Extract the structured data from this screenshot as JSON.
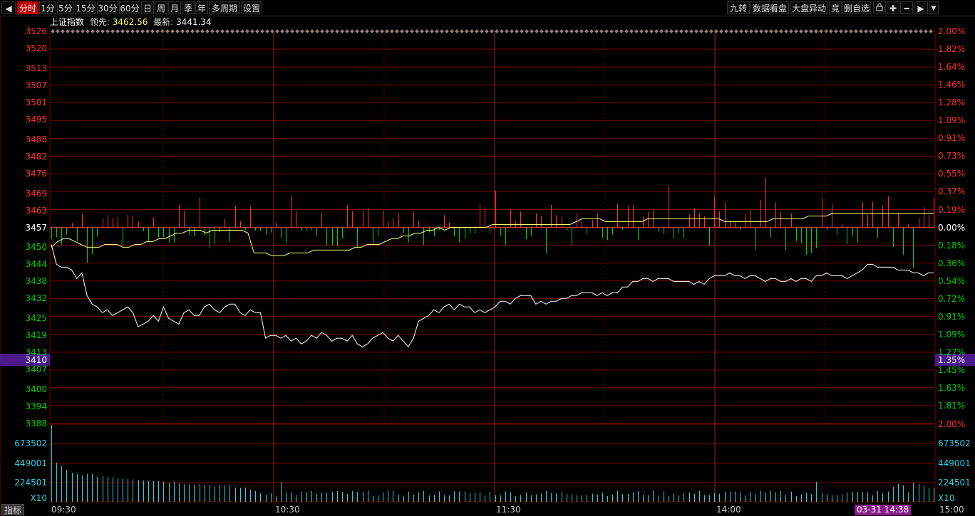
{
  "toolbar": {
    "period_tabs": [
      {
        "label": "分时",
        "active": true
      },
      {
        "label": "1分",
        "active": false
      },
      {
        "label": "5分",
        "active": false
      },
      {
        "label": "15分",
        "active": false
      },
      {
        "label": "30分",
        "active": false
      },
      {
        "label": "60分",
        "active": false
      },
      {
        "label": "日",
        "active": false
      },
      {
        "label": "周",
        "active": false
      },
      {
        "label": "月",
        "active": false
      },
      {
        "label": "季",
        "active": false
      },
      {
        "label": "年",
        "active": false
      },
      {
        "label": "多周期",
        "active": false
      },
      {
        "label": "设置",
        "active": false
      }
    ],
    "right_buttons": [
      "九转",
      "数据看盘",
      "大盘异动",
      "竞",
      "删自选"
    ],
    "icons": [
      "prev-arrow-icon",
      "lock-icon",
      "plus-icon",
      "minus-icon",
      "next-arrow-icon",
      "dropdown-arrow-icon"
    ]
  },
  "info": {
    "index_name": "上证指数",
    "leader_label": "领先:",
    "leader_value": "3462.56",
    "latest_label": "最新:",
    "latest_value": "3441.34"
  },
  "price_axis_left": [
    "3526",
    "3520",
    "3513",
    "3507",
    "3501",
    "3495",
    "3488",
    "3482",
    "3476",
    "3469",
    "3463",
    "3457",
    "3450",
    "3444",
    "3438",
    "3432",
    "3425",
    "3419",
    "3413",
    "3410",
    "3407",
    "3400",
    "3394",
    "3388"
  ],
  "price_axis_right": [
    "2.00%",
    "1.82%",
    "1.64%",
    "1.46%",
    "1.28%",
    "1.09%",
    "0.91%",
    "0.73%",
    "0.55%",
    "0.37%",
    "0.19%",
    "0.00%",
    "0.18%",
    "0.36%",
    "0.54%",
    "0.72%",
    "0.91%",
    "1.09%",
    "1.27%",
    "1.35%",
    "1.45%",
    "1.63%",
    "1.81%"
  ],
  "crosshair": {
    "price": "3410",
    "pct": "1.35%"
  },
  "volume_axis_left": [
    "673502",
    "449001",
    "224501",
    "X10"
  ],
  "volume_axis_right": [
    "2.00%",
    "673502",
    "449001",
    "224501",
    "X10"
  ],
  "bottom": {
    "indicator_label": "指标",
    "time_labels": [
      "09:30",
      "10:30",
      "11:30",
      "14:00",
      "15:00"
    ],
    "cursor_time": "03-31 14:38"
  },
  "colors": {
    "up": "#ff3030",
    "down": "#00d000",
    "price_line": "#ffffff",
    "avg_line": "#ffff66",
    "grid": "#7a0000",
    "volume": "#30d0e0",
    "crosshair_bg": "#4a1a8a",
    "active_tab": "#c00000"
  },
  "chart_data": {
    "type": "line",
    "title": "上证指数",
    "y_range": [
      3388,
      3526
    ],
    "prev_close": 3457,
    "time_axis": [
      "09:30",
      "10:30",
      "11:30",
      "14:00",
      "15:00"
    ],
    "price": [
      3451,
      3444,
      3443,
      3443,
      3442,
      3439,
      3441,
      3433,
      3430,
      3429,
      3427,
      3428,
      3426,
      3427,
      3428,
      3429,
      3427,
      3422,
      3423,
      3424,
      3426,
      3424,
      3429,
      3425,
      3424,
      3423,
      3427,
      3428,
      3426,
      3426,
      3429,
      3430,
      3428,
      3427,
      3429,
      3430,
      3430,
      3427,
      3426,
      3428,
      3427,
      3427,
      3418,
      3419,
      3419,
      3418,
      3419,
      3417,
      3418,
      3416,
      3417,
      3419,
      3418,
      3420,
      3419,
      3417,
      3418,
      3418,
      3417,
      3419,
      3416,
      3415,
      3416,
      3418,
      3419,
      3420,
      3418,
      3417,
      3419,
      3417,
      3415,
      3418,
      3424,
      3425,
      3426,
      3428,
      3427,
      3429,
      3430,
      3428,
      3430,
      3429,
      3429,
      3427,
      3428,
      3427,
      3428,
      3429,
      3431,
      3431,
      3430,
      3432,
      3433,
      3433,
      3433,
      3430,
      3431,
      3430,
      3431,
      3431,
      3432,
      3432,
      3433,
      3433,
      3434,
      3434,
      3434,
      3433,
      3434,
      3433,
      3434,
      3434,
      3436,
      3436,
      3438,
      3438,
      3439,
      3439,
      3438,
      3439,
      3439,
      3439,
      3438,
      3438,
      3438,
      3438,
      3437,
      3438,
      3437,
      3439,
      3440,
      3440,
      3440,
      3441,
      3440,
      3440,
      3439,
      3440,
      3440,
      3439,
      3438,
      3439,
      3439,
      3438,
      3438,
      3439,
      3438,
      3439,
      3439,
      3438,
      3440,
      3440,
      3441,
      3440,
      3440,
      3440,
      3439,
      3440,
      3441,
      3442,
      3444,
      3444,
      3443,
      3443,
      3443,
      3443,
      3442,
      3442,
      3442,
      3441,
      3441,
      3440,
      3441,
      3441
    ],
    "average": [
      3450,
      3452,
      3453,
      3453,
      3452,
      3451,
      3450,
      3450,
      3450,
      3451,
      3451,
      3451,
      3450,
      3450,
      3451,
      3451,
      3452,
      3452,
      3453,
      3453,
      3454,
      3455,
      3455,
      3456,
      3456,
      3456,
      3455,
      3456,
      3456,
      3456,
      3456,
      3456,
      3456,
      3455,
      3448,
      3448,
      3448,
      3447,
      3447,
      3447,
      3448,
      3448,
      3448,
      3448,
      3449,
      3449,
      3449,
      3449,
      3449,
      3449,
      3449,
      3450,
      3450,
      3451,
      3451,
      3451,
      3452,
      3453,
      3453,
      3454,
      3454,
      3455,
      3455,
      3456,
      3456,
      3457,
      3456,
      3457,
      3457,
      3457,
      3457,
      3457,
      3457,
      3457,
      3458,
      3458,
      3458,
      3458,
      3458,
      3458,
      3458,
      3458,
      3458,
      3458,
      3458,
      3458,
      3458,
      3458,
      3459,
      3460,
      3460,
      3460,
      3460,
      3459,
      3459,
      3459,
      3459,
      3459,
      3459,
      3459,
      3460,
      3460,
      3460,
      3460,
      3460,
      3460,
      3460,
      3460,
      3460,
      3460,
      3460,
      3460,
      3460,
      3459,
      3459,
      3459,
      3459,
      3459,
      3459,
      3459,
      3459,
      3460,
      3460,
      3460,
      3460,
      3460,
      3460,
      3461,
      3461,
      3461,
      3461,
      3462,
      3462,
      3462,
      3462,
      3462,
      3462,
      3462,
      3462,
      3462,
      3462,
      3462,
      3462,
      3462,
      3462,
      3462,
      3462,
      3462,
      3462
    ]
  }
}
